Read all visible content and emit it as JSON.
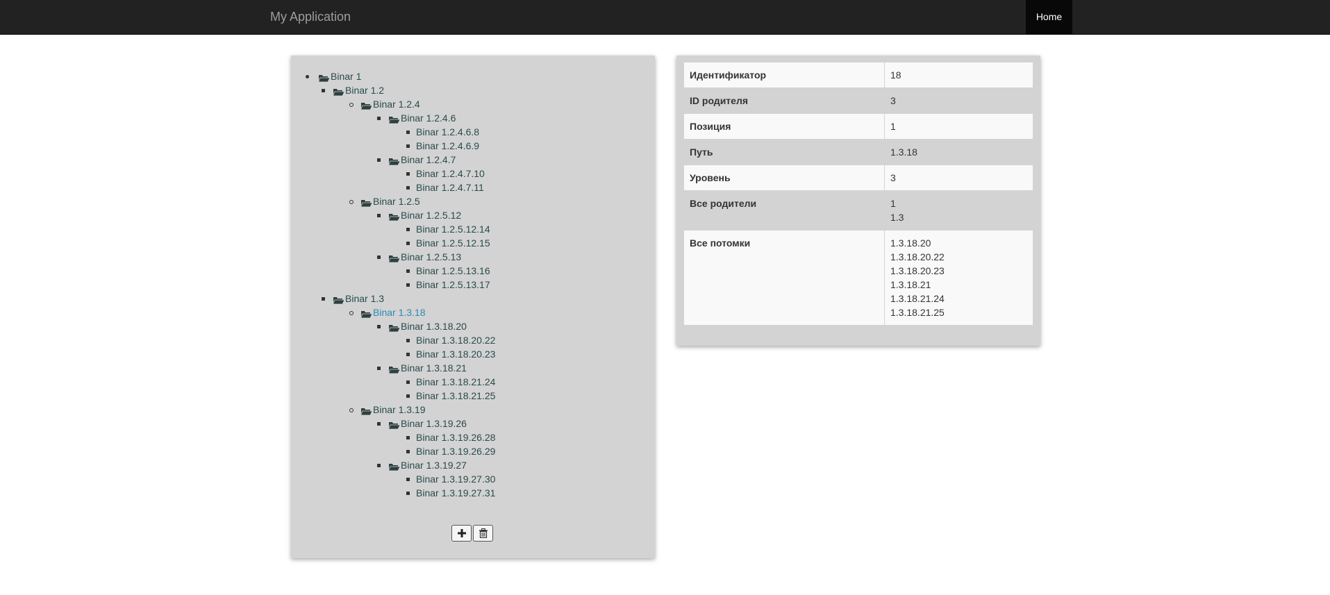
{
  "navbar": {
    "brand": "My Application",
    "home": "Home"
  },
  "tree": {
    "nodes": [
      {
        "label": "Binar 1",
        "depth": 0,
        "folder": true,
        "selected": false
      },
      {
        "label": "Binar 1.2",
        "depth": 1,
        "folder": true,
        "selected": false
      },
      {
        "label": "Binar 1.2.4",
        "depth": 2,
        "folder": true,
        "selected": false
      },
      {
        "label": "Binar 1.2.4.6",
        "depth": 3,
        "folder": true,
        "selected": false
      },
      {
        "label": "Binar 1.2.4.6.8",
        "depth": 4,
        "folder": false,
        "selected": false
      },
      {
        "label": "Binar 1.2.4.6.9",
        "depth": 4,
        "folder": false,
        "selected": false
      },
      {
        "label": "Binar 1.2.4.7",
        "depth": 3,
        "folder": true,
        "selected": false
      },
      {
        "label": "Binar 1.2.4.7.10",
        "depth": 4,
        "folder": false,
        "selected": false
      },
      {
        "label": "Binar 1.2.4.7.11",
        "depth": 4,
        "folder": false,
        "selected": false
      },
      {
        "label": "Binar 1.2.5",
        "depth": 2,
        "folder": true,
        "selected": false
      },
      {
        "label": "Binar 1.2.5.12",
        "depth": 3,
        "folder": true,
        "selected": false
      },
      {
        "label": "Binar 1.2.5.12.14",
        "depth": 4,
        "folder": false,
        "selected": false
      },
      {
        "label": "Binar 1.2.5.12.15",
        "depth": 4,
        "folder": false,
        "selected": false
      },
      {
        "label": "Binar 1.2.5.13",
        "depth": 3,
        "folder": true,
        "selected": false
      },
      {
        "label": "Binar 1.2.5.13.16",
        "depth": 4,
        "folder": false,
        "selected": false
      },
      {
        "label": "Binar 1.2.5.13.17",
        "depth": 4,
        "folder": false,
        "selected": false
      },
      {
        "label": "Binar 1.3",
        "depth": 1,
        "folder": true,
        "selected": false
      },
      {
        "label": "Binar 1.3.18",
        "depth": 2,
        "folder": true,
        "selected": true
      },
      {
        "label": "Binar 1.3.18.20",
        "depth": 3,
        "folder": true,
        "selected": false
      },
      {
        "label": "Binar 1.3.18.20.22",
        "depth": 4,
        "folder": false,
        "selected": false
      },
      {
        "label": "Binar 1.3.18.20.23",
        "depth": 4,
        "folder": false,
        "selected": false
      },
      {
        "label": "Binar 1.3.18.21",
        "depth": 3,
        "folder": true,
        "selected": false
      },
      {
        "label": "Binar 1.3.18.21.24",
        "depth": 4,
        "folder": false,
        "selected": false
      },
      {
        "label": "Binar 1.3.18.21.25",
        "depth": 4,
        "folder": false,
        "selected": false
      },
      {
        "label": "Binar 1.3.19",
        "depth": 2,
        "folder": true,
        "selected": false
      },
      {
        "label": "Binar 1.3.19.26",
        "depth": 3,
        "folder": true,
        "selected": false
      },
      {
        "label": "Binar 1.3.19.26.28",
        "depth": 4,
        "folder": false,
        "selected": false
      },
      {
        "label": "Binar 1.3.19.26.29",
        "depth": 4,
        "folder": false,
        "selected": false
      },
      {
        "label": "Binar 1.3.19.27",
        "depth": 3,
        "folder": true,
        "selected": false
      },
      {
        "label": "Binar 1.3.19.27.30",
        "depth": 4,
        "folder": false,
        "selected": false
      },
      {
        "label": "Binar 1.3.19.27.31",
        "depth": 4,
        "folder": false,
        "selected": false
      }
    ],
    "buttons": {
      "add_icon": "plus-icon",
      "delete_icon": "trash-icon"
    }
  },
  "details": {
    "rows": [
      {
        "key": "Идентификатор",
        "values": [
          "18"
        ]
      },
      {
        "key": "ID родителя",
        "values": [
          "3"
        ]
      },
      {
        "key": "Позиция",
        "values": [
          "1"
        ]
      },
      {
        "key": "Путь",
        "values": [
          "1.3.18"
        ]
      },
      {
        "key": "Уровень",
        "values": [
          "3"
        ]
      },
      {
        "key": "Все родители",
        "values": [
          "1",
          "1.3"
        ]
      },
      {
        "key": "Все потомки",
        "values": [
          "1.3.18.20",
          "1.3.18.20.22",
          "1.3.18.20.23",
          "1.3.18.21",
          "1.3.18.21.24",
          "1.3.18.21.25"
        ]
      }
    ]
  },
  "colors": {
    "navbar_bg": "#222222",
    "panel_bg": "#d3d3d3",
    "link": "#2a4a4a",
    "selected_link": "#2a8ab8"
  }
}
